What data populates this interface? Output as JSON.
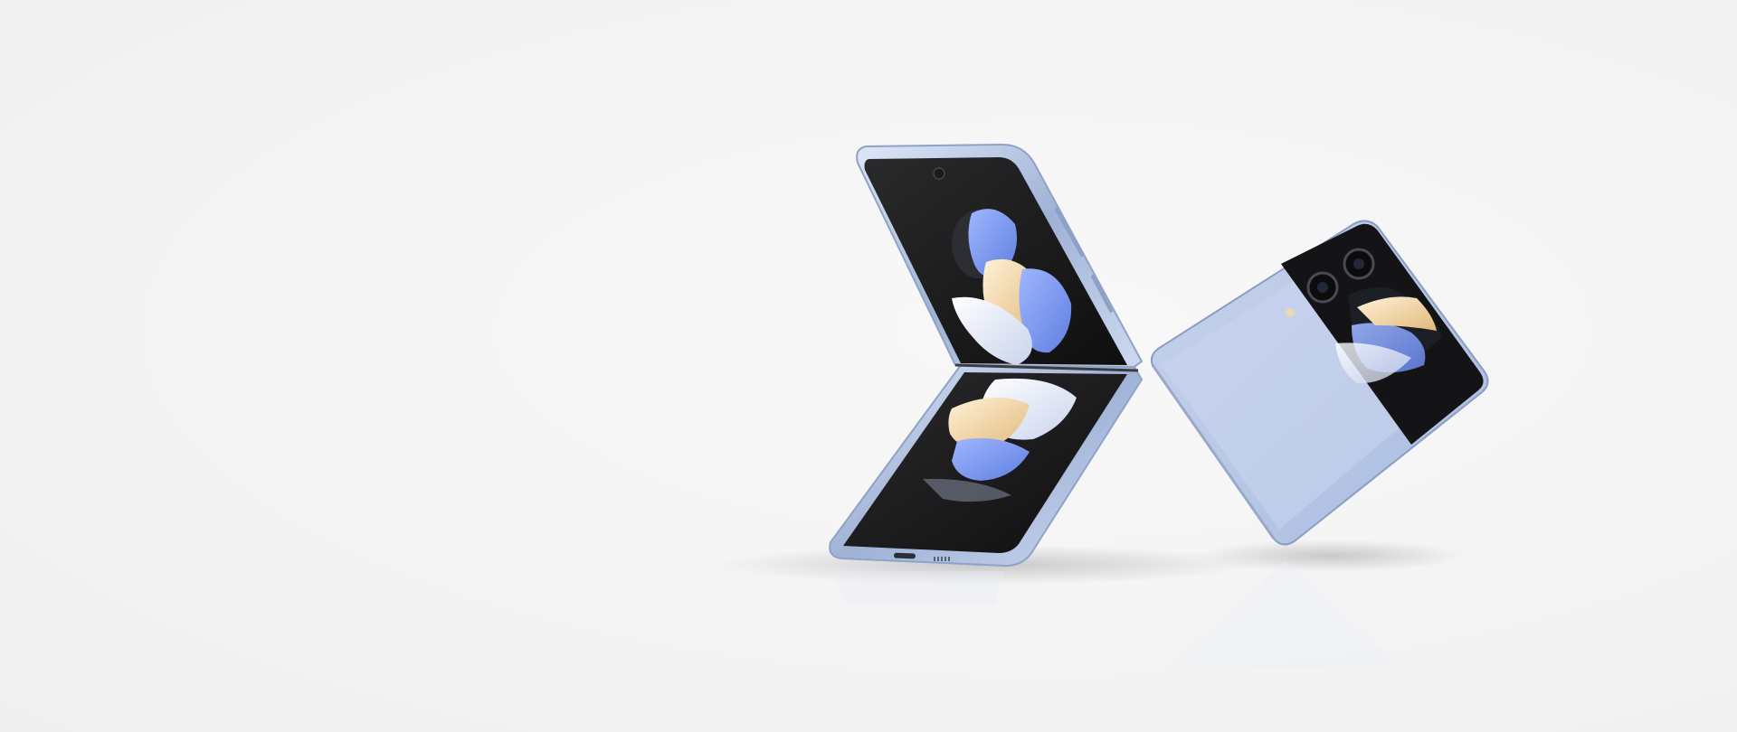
{
  "scene": {
    "background_color": "#f4f4f4",
    "subject": "foldable-phone-pair",
    "phone_color": "#b9c9e6"
  }
}
